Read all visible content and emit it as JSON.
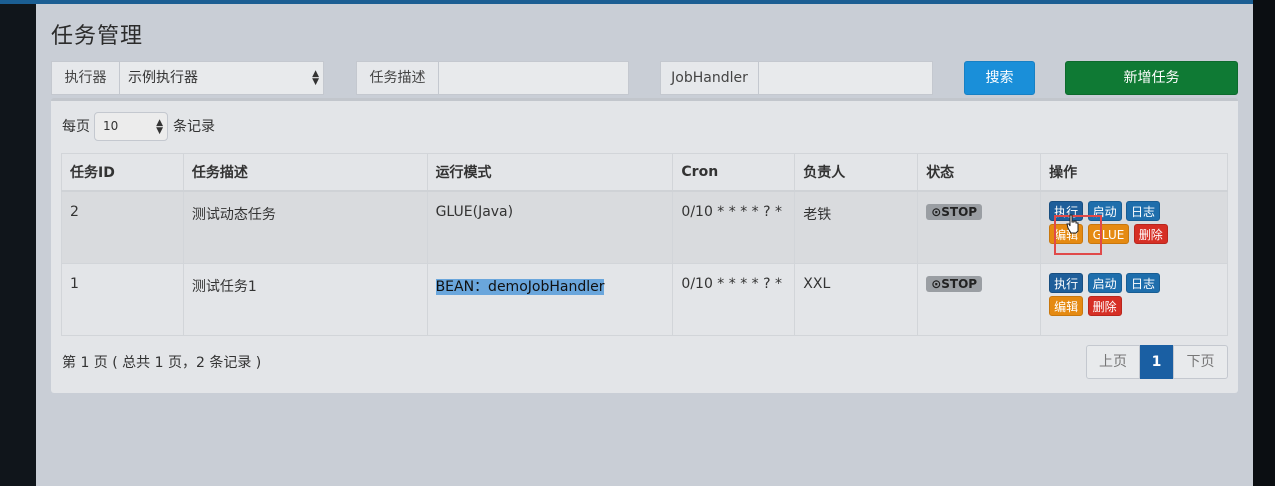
{
  "page": {
    "title": "任务管理"
  },
  "filters": {
    "executor_label": "执行器",
    "executor_value": "示例执行器",
    "desc_label": "任务描述",
    "desc_value": "",
    "handler_label": "JobHandler",
    "handler_value": "",
    "search_label": "搜索",
    "add_label": "新增任务"
  },
  "paging": {
    "per_page_prefix": "每页",
    "per_page_value": "10",
    "per_page_suffix": "条记录",
    "summary": "第 1 页 ( 总共 1 页，2 条记录 )",
    "prev_label": "上页",
    "current_page": "1",
    "next_label": "下页"
  },
  "table": {
    "headers": [
      "任务ID",
      "任务描述",
      "运行模式",
      "Cron",
      "负责人",
      "状态",
      "操作"
    ],
    "rows": [
      {
        "id": "2",
        "desc": "测试动态任务",
        "mode": "GLUE(Java)",
        "cron": "0/10 * * * * ? *",
        "owner": "老铁",
        "status": "⊙STOP",
        "actions": {
          "exec": "执行",
          "start": "启动",
          "log": "日志",
          "edit": "编辑",
          "glue": "GLUE",
          "delete": "删除"
        }
      },
      {
        "id": "1",
        "desc": "测试任务1",
        "mode": "BEAN：demoJobHandler",
        "cron": "0/10 * * * * ? *",
        "owner": "XXL",
        "status": "⊙STOP",
        "actions": {
          "exec": "执行",
          "start": "启动",
          "log": "日志",
          "edit": "编辑",
          "delete": "删除"
        }
      }
    ]
  },
  "icons": {
    "select_arrow": "updown-arrow-icon",
    "cursor": "hand-pointer-icon"
  },
  "colors": {
    "primary": "#1a8fd9",
    "success": "#0f7a34",
    "warning": "#e58a12",
    "danger": "#d62f25",
    "highlight_box": "#e04a4a"
  }
}
